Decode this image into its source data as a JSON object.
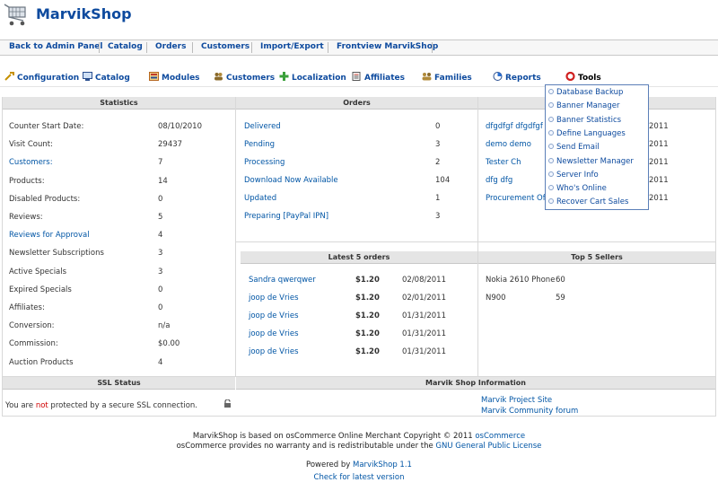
{
  "app": {
    "title": "MarvikShop"
  },
  "top_nav": [
    "Back to Admin Panel",
    "Catalog",
    "Orders",
    "Customers",
    "Import/Export",
    "Frontview MarvikShop"
  ],
  "main_nav": [
    {
      "label": "Configuration",
      "icon": "wrench-icon"
    },
    {
      "label": "Catalog",
      "icon": "monitor-icon"
    },
    {
      "label": "Modules",
      "icon": "modules-icon"
    },
    {
      "label": "Customers",
      "icon": "customers-icon"
    },
    {
      "label": "Localization",
      "icon": "plus-icon"
    },
    {
      "label": "Affiliates",
      "icon": "affiliates-icon"
    },
    {
      "label": "Families",
      "icon": "families-icon"
    },
    {
      "label": "Reports",
      "icon": "reports-icon"
    },
    {
      "label": "Tools",
      "icon": "lifebuoy-icon"
    }
  ],
  "tools_menu": [
    "Database Backup",
    "Banner Manager",
    "Banner Statistics",
    "Define Languages",
    "Send Email",
    "Newsletter Manager",
    "Server Info",
    "Who's Online",
    "Recover Cart Sales"
  ],
  "statistics": {
    "header": "Statistics",
    "rows": [
      {
        "label": "Counter Start Date:",
        "value": "08/10/2010",
        "link": false
      },
      {
        "label": "Visit Count:",
        "value": "29437",
        "link": false
      },
      {
        "label": "Customers:",
        "value": "7",
        "link": true
      },
      {
        "label": "Products:",
        "value": "14",
        "link": false
      },
      {
        "label": "Disabled Products:",
        "value": "0",
        "link": false
      },
      {
        "label": "Reviews:",
        "value": "5",
        "link": false
      },
      {
        "label": "Reviews for Approval",
        "value": "4",
        "link": true
      },
      {
        "label": "Newsletter Subscriptions",
        "value": "3",
        "link": false
      },
      {
        "label": "Active Specials",
        "value": "3",
        "link": false
      },
      {
        "label": "Expired Specials",
        "value": "0",
        "link": false
      },
      {
        "label": "Affiliates:",
        "value": "0",
        "link": false
      },
      {
        "label": "Conversion:",
        "value": "n/a",
        "link": false
      },
      {
        "label": "Commission:",
        "value": "$0.00",
        "link": false
      },
      {
        "label": "Auction Products",
        "value": "4",
        "link": false
      }
    ]
  },
  "orders": {
    "header": "Orders",
    "rows": [
      {
        "label": "Delivered",
        "value": "0"
      },
      {
        "label": "Pending",
        "value": "3"
      },
      {
        "label": "Processing",
        "value": "2"
      },
      {
        "label": "Download Now Available",
        "value": "104"
      },
      {
        "label": "Updated",
        "value": "1"
      },
      {
        "label": "Preparing [PayPal IPN]",
        "value": "3"
      }
    ]
  },
  "customers_panel": {
    "rows": [
      {
        "name": "dfgdfgf dfgdfgf",
        "date": "2011"
      },
      {
        "name": "demo demo",
        "date": "2011"
      },
      {
        "name": "Tester Ch",
        "date": "2011"
      },
      {
        "name": "dfg dfg",
        "date": "2011"
      },
      {
        "name": "Procurement Offic",
        "date": "2011"
      }
    ]
  },
  "latest_orders": {
    "header": "Latest 5 orders",
    "rows": [
      {
        "name": "Sandra qwerqwer",
        "amount": "$1.20",
        "date": "02/08/2011"
      },
      {
        "name": "joop de Vries",
        "amount": "$1.20",
        "date": "02/01/2011"
      },
      {
        "name": "joop de Vries",
        "amount": "$1.20",
        "date": "01/31/2011"
      },
      {
        "name": "joop de Vries",
        "amount": "$1.20",
        "date": "01/31/2011"
      },
      {
        "name": "joop de Vries",
        "amount": "$1.20",
        "date": "01/31/2011"
      }
    ]
  },
  "top_sellers": {
    "header": "Top 5 Sellers",
    "rows": [
      {
        "name": "Nokia 2610 Phone",
        "count": "60"
      },
      {
        "name": "N900",
        "count": "59"
      }
    ]
  },
  "ssl": {
    "header": "SSL Status",
    "prefix": "You are ",
    "warn": "not",
    "suffix": " protected by a secure SSL connection."
  },
  "shop_info": {
    "header": "Marvik Shop Information",
    "links": [
      "Marvik Project Site",
      "Marvik Community forum"
    ]
  },
  "footer": {
    "line1_prefix": "MarvikShop is based on osCommerce Online Merchant Copyright © 2011 ",
    "line1_link": "osCommerce",
    "line2_prefix": "osCommerce provides no warranty and is redistributable under the ",
    "line2_link": "GNU General Public License",
    "powered_prefix": "Powered by ",
    "powered_link": "MarvikShop 1.1",
    "check": "Check for latest version"
  }
}
